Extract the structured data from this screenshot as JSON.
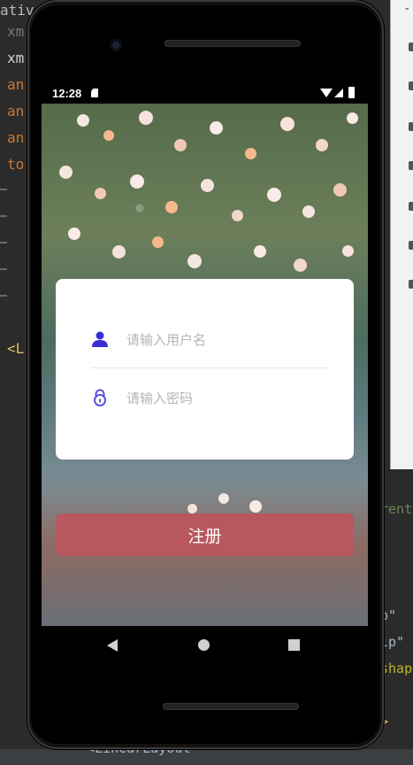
{
  "ide": {
    "code_lines": [
      "xm",
      "xm",
      "an",
      "an",
      "an",
      "to",
      "<L"
    ],
    "top_fragment": "ativ",
    "right_fragments": [
      "-",
      "rent",
      "p\"",
      "lp\"",
      "shap",
      ">"
    ],
    "bottom_fragment": "<LinearLayout"
  },
  "status_bar": {
    "time": "12:28"
  },
  "login_card": {
    "username_placeholder": "请输入用户名",
    "password_placeholder": "请输入密码"
  },
  "register_button": {
    "label": "注册"
  },
  "colors": {
    "accent_icon": "#3a2fd6",
    "button": "#b9575f"
  },
  "icons": {
    "username": "user-icon",
    "password": "lock-icon",
    "nav_back": "back-triangle-icon",
    "nav_home": "home-circle-icon",
    "nav_recents": "recents-square-icon"
  }
}
